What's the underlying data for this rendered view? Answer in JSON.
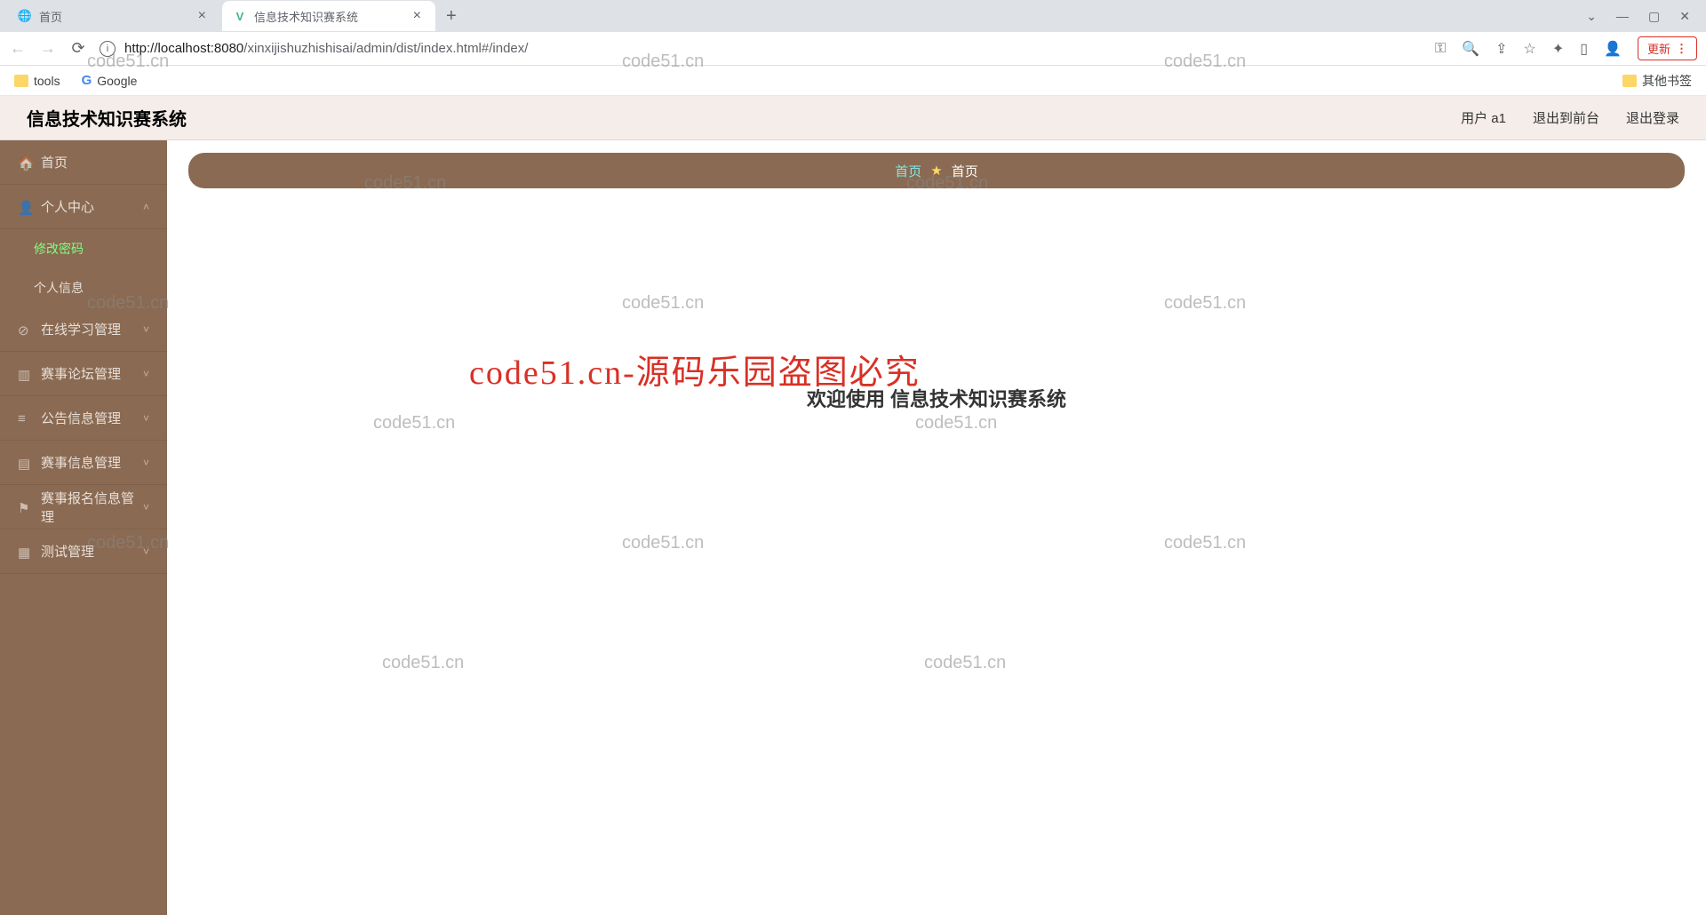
{
  "browser": {
    "tabs": [
      {
        "title": "首页",
        "active": false
      },
      {
        "title": "信息技术知识赛系统",
        "active": true
      }
    ],
    "url_host": "localhost",
    "url_port": ":8080",
    "url_path": "/xinxijishuzhishisai/admin/dist/index.html#/index/",
    "update_label": "更新"
  },
  "bookmarks": {
    "items": [
      "tools",
      "Google"
    ],
    "other": "其他书签"
  },
  "header": {
    "title": "信息技术知识赛系统",
    "user_label": "用户 a1",
    "to_front": "退出到前台",
    "logout": "退出登录"
  },
  "sidebar": {
    "items": [
      {
        "label": "首页",
        "icon": "home"
      },
      {
        "label": "个人中心",
        "icon": "user",
        "expanded": true,
        "children": [
          {
            "label": "修改密码",
            "active": true
          },
          {
            "label": "个人信息",
            "active": false
          }
        ]
      },
      {
        "label": "在线学习管理",
        "icon": "book"
      },
      {
        "label": "赛事论坛管理",
        "icon": "forum"
      },
      {
        "label": "公告信息管理",
        "icon": "notice"
      },
      {
        "label": "赛事信息管理",
        "icon": "event"
      },
      {
        "label": "赛事报名信息管理",
        "icon": "flag"
      },
      {
        "label": "测试管理",
        "icon": "test"
      }
    ]
  },
  "breadcrumb": {
    "first": "首页",
    "second": "首页"
  },
  "welcome": "欢迎使用 信息技术知识赛系统",
  "watermarks": {
    "text": "code51.cn",
    "red": "code51.cn-源码乐园盗图必究"
  }
}
